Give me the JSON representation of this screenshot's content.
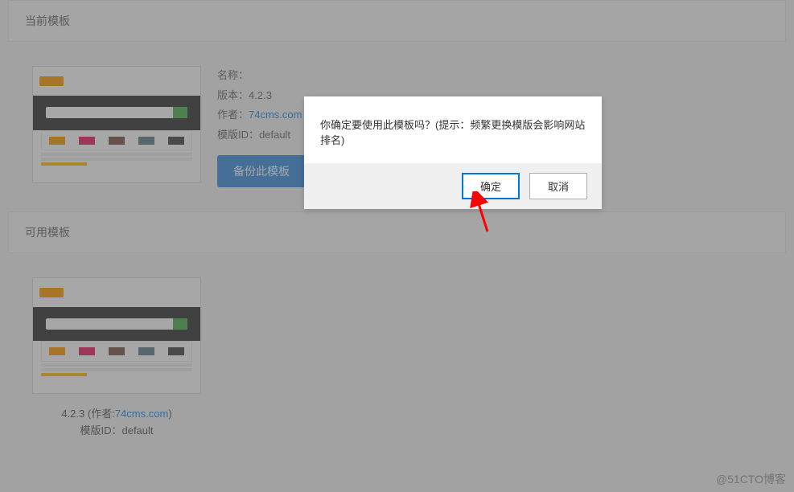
{
  "sections": {
    "current": "当前模板",
    "available": "可用模板"
  },
  "template": {
    "name_label": "名称：",
    "version_label": "版本：",
    "version_value": "4.2.3",
    "author_label": "作者：",
    "author_link": "74cms.com",
    "id_label": "模版ID：",
    "id_value": "default",
    "backup_button": "备份此模板"
  },
  "available_template": {
    "version": "4.2.3",
    "author_prefix": "(作者:",
    "author_link": "74cms.com",
    "author_suffix": ")",
    "id_label": "模版ID：",
    "id_value": "default"
  },
  "dialog": {
    "message": "你确定要使用此模板吗？(提示：频繁更换模版会影响网站排名)",
    "ok": "确定",
    "cancel": "取消"
  },
  "watermark": "@51CTO博客"
}
